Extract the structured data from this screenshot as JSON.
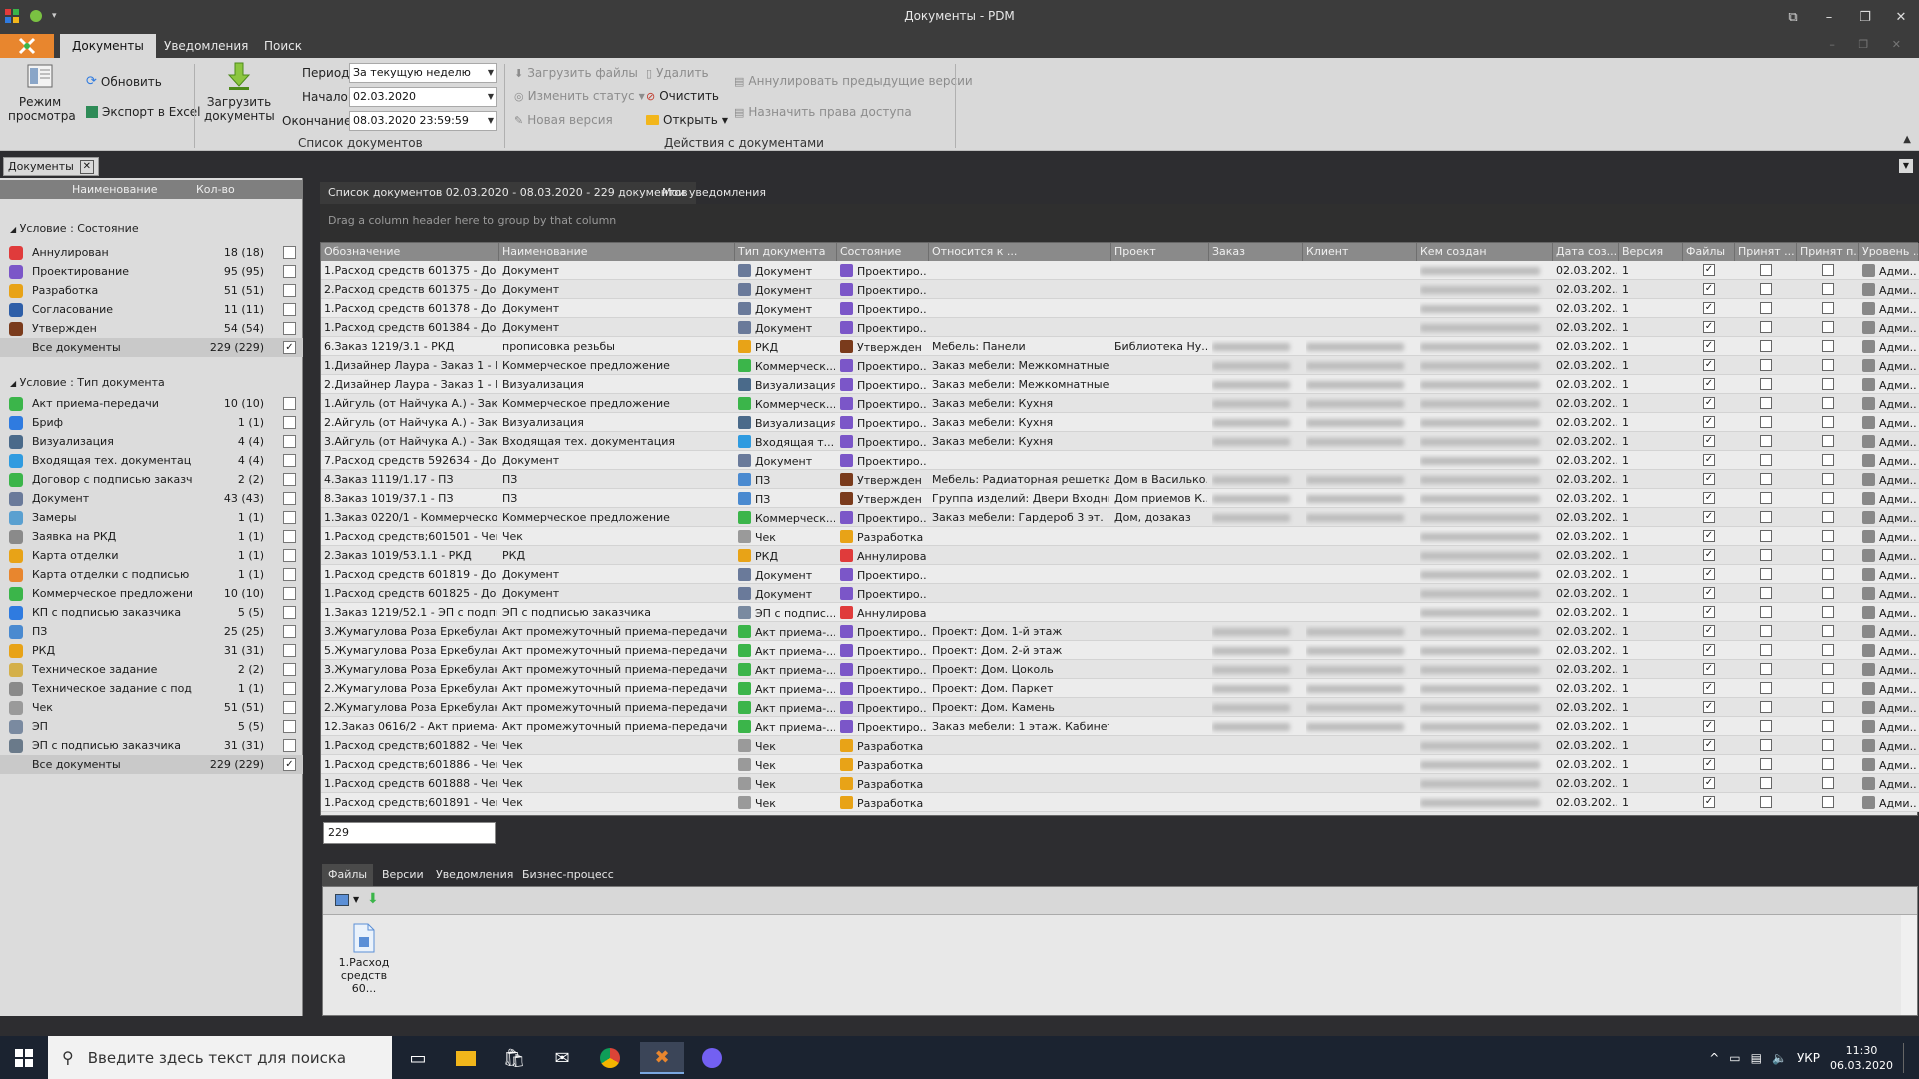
{
  "window": {
    "title": "Документы - PDM"
  },
  "ribbon_tabs": [
    "Документы",
    "Уведомления",
    "Поиск"
  ],
  "ribbon": {
    "view_mode": "Режим\nпросмотра",
    "refresh": "Обновить",
    "export_excel": "Экспорт в Excel",
    "load_docs": "Загрузить\nдокументы",
    "period_label": "Период",
    "period_value": "За текущую неделю",
    "start_label": "Начало",
    "start_value": "02.03.2020",
    "end_label": "Окончание",
    "end_value": "08.03.2020 23:59:59",
    "group_list": "Список документов",
    "load_files": "Загрузить файлы",
    "change_status": "Изменить статус",
    "new_version": "Новая версия",
    "delete": "Удалить",
    "clear": "Очистить",
    "open": "Открыть",
    "annul_prev": "Аннулировать предыдущие версии",
    "assign_rights": "Назначить права доступа",
    "group_actions": "Действия с документами"
  },
  "doc_tab": "Документы",
  "left_panel": {
    "col_name": "Наименование",
    "col_count": "Кол-во",
    "cond_state": "Условие : Состояние",
    "states": [
      {
        "name": "Аннулирован",
        "count": "18 (18)",
        "checked": false,
        "icon": "annulled-icon"
      },
      {
        "name": "Проектирование",
        "count": "95 (95)",
        "checked": false,
        "icon": "design-pen-icon"
      },
      {
        "name": "Разработка",
        "count": "51 (51)",
        "checked": false,
        "icon": "pencil-icon"
      },
      {
        "name": "Согласование",
        "count": "11 (11)",
        "checked": false,
        "icon": "approval-icon"
      },
      {
        "name": "Утвержден",
        "count": "54 (54)",
        "checked": false,
        "icon": "stamp-icon"
      },
      {
        "name": "Все документы",
        "count": "229 (229)",
        "checked": true,
        "icon": ""
      }
    ],
    "cond_type": "Условие : Тип документа",
    "types": [
      {
        "name": "Акт приема-передачи",
        "count": "10 (10)",
        "checked": false,
        "icon": "act-icon"
      },
      {
        "name": "Бриф",
        "count": "1 (1)",
        "checked": false,
        "icon": "info-icon"
      },
      {
        "name": "Визуализация",
        "count": "4 (4)",
        "checked": false,
        "icon": "image-icon"
      },
      {
        "name": "Входящая тех. документация",
        "count": "4 (4)",
        "checked": false,
        "icon": "incoming-icon"
      },
      {
        "name": "Договор с подписью заказч...",
        "count": "2 (2)",
        "checked": false,
        "icon": "contract-icon"
      },
      {
        "name": "Документ",
        "count": "43 (43)",
        "checked": false,
        "icon": "document-icon"
      },
      {
        "name": "Замеры",
        "count": "1 (1)",
        "checked": false,
        "icon": "measure-icon"
      },
      {
        "name": "Заявка на РКД",
        "count": "1 (1)",
        "checked": false,
        "icon": "request-icon"
      },
      {
        "name": "Карта отделки",
        "count": "1 (1)",
        "checked": false,
        "icon": "finish-map-icon"
      },
      {
        "name": "Карта отделки с подписью ...",
        "count": "1 (1)",
        "checked": false,
        "icon": "finish-map-signed-icon"
      },
      {
        "name": "Коммерческое предложение",
        "count": "10 (10)",
        "checked": false,
        "icon": "offer-icon"
      },
      {
        "name": "КП с подписью заказчика",
        "count": "5 (5)",
        "checked": false,
        "icon": "offer-signed-icon"
      },
      {
        "name": "ПЗ",
        "count": "25 (25)",
        "checked": false,
        "icon": "pz-icon"
      },
      {
        "name": "РКД",
        "count": "31 (31)",
        "checked": false,
        "icon": "rkd-icon"
      },
      {
        "name": "Техническое задание",
        "count": "2 (2)",
        "checked": false,
        "icon": "tz-icon"
      },
      {
        "name": "Техническое задание с под...",
        "count": "1 (1)",
        "checked": false,
        "icon": "tz-signed-icon"
      },
      {
        "name": "Чек",
        "count": "51 (51)",
        "checked": false,
        "icon": "receipt-icon"
      },
      {
        "name": "ЭП",
        "count": "5 (5)",
        "checked": false,
        "icon": "ep-icon"
      },
      {
        "name": "ЭП с подписью заказчика",
        "count": "31 (31)",
        "checked": false,
        "icon": "ep-signed-icon"
      },
      {
        "name": "Все документы",
        "count": "229 (229)",
        "checked": true,
        "icon": ""
      }
    ]
  },
  "main_tabs": [
    "Список документов 02.03.2020 - 08.03.2020 - 229 документов",
    "Мои уведомления"
  ],
  "group_hint": "Drag a column header here to group by that column",
  "grid": {
    "columns": [
      "Обозначение",
      "Наименование",
      "Тип документа",
      "Состояние",
      "Относится к ...",
      "Проект",
      "Заказ",
      "Клиент",
      "Кем создан",
      "Дата соз...",
      "Версия",
      "Файлы",
      "Принят ...",
      "Принят п...",
      "Уровень ..."
    ],
    "rows": [
      {
        "d": "1.Расход средств 601375 - Док...",
        "n": "Документ",
        "t": "Документ",
        "s": "Проектиро...",
        "r": "",
        "p": "",
        "o": false,
        "c": false,
        "date": "02.03.202...",
        "v": "1",
        "lvl": "Адми...",
        "ti": "document",
        "si": "design"
      },
      {
        "d": "2.Расход средств 601375 - Док...",
        "n": "Документ",
        "t": "Документ",
        "s": "Проектиро...",
        "r": "",
        "p": "",
        "o": false,
        "c": false,
        "date": "02.03.202...",
        "v": "1",
        "lvl": "Адми...",
        "ti": "document",
        "si": "design"
      },
      {
        "d": "1.Расход средств 601378 - Док...",
        "n": "Документ",
        "t": "Документ",
        "s": "Проектиро...",
        "r": "",
        "p": "",
        "o": false,
        "c": false,
        "date": "02.03.202...",
        "v": "1",
        "lvl": "Адми...",
        "ti": "document",
        "si": "design"
      },
      {
        "d": "1.Расход средств 601384 - Док...",
        "n": "Документ",
        "t": "Документ",
        "s": "Проектиро...",
        "r": "",
        "p": "",
        "o": false,
        "c": false,
        "date": "02.03.202...",
        "v": "1",
        "lvl": "Адми...",
        "ti": "document",
        "si": "design"
      },
      {
        "d": "6.Заказ 1219/3.1 - РКД",
        "n": "прописовка резьбы",
        "t": "РКД",
        "s": "Утвержден",
        "r": "Мебель: Панели",
        "p": "Библиотека Ну...",
        "o": true,
        "c": true,
        "date": "02.03.202...",
        "v": "1",
        "lvl": "Адми...",
        "ti": "rkd",
        "si": "approved"
      },
      {
        "d": "1.Дизайнер Лаура - Заказ 1 - К...",
        "n": "Коммерческое предложение",
        "t": "Коммерческ...",
        "s": "Проектиро...",
        "r": "Заказ мебели: Межкомнатные д...",
        "p": "",
        "o": true,
        "c": true,
        "date": "02.03.202...",
        "v": "1",
        "lvl": "Адми...",
        "ti": "offer",
        "si": "design"
      },
      {
        "d": "2.Дизайнер Лаура - Заказ 1 - Ви...",
        "n": "Визуализация",
        "t": "Визуализация",
        "s": "Проектиро...",
        "r": "Заказ мебели: Межкомнатные д...",
        "p": "",
        "o": true,
        "c": true,
        "date": "02.03.202...",
        "v": "1",
        "lvl": "Адми...",
        "ti": "image",
        "si": "design"
      },
      {
        "d": "1.Айгуль (от Найчука А.) - Зака...",
        "n": "Коммерческое предложение",
        "t": "Коммерческ...",
        "s": "Проектиро...",
        "r": "Заказ мебели: Кухня",
        "p": "",
        "o": true,
        "c": true,
        "date": "02.03.202...",
        "v": "1",
        "lvl": "Адми...",
        "ti": "offer",
        "si": "design"
      },
      {
        "d": "2.Айгуль (от Найчука А.) - Зака...",
        "n": "Визуализация",
        "t": "Визуализация",
        "s": "Проектиро...",
        "r": "Заказ мебели: Кухня",
        "p": "",
        "o": true,
        "c": true,
        "date": "02.03.202...",
        "v": "1",
        "lvl": "Адми...",
        "ti": "image",
        "si": "design"
      },
      {
        "d": "3.Айгуль (от Найчука А.) - Зака...",
        "n": "Входящая тех. документация",
        "t": "Входящая т...",
        "s": "Проектиро...",
        "r": "Заказ мебели: Кухня",
        "p": "",
        "o": true,
        "c": true,
        "date": "02.03.202...",
        "v": "1",
        "lvl": "Адми...",
        "ti": "incoming",
        "si": "design"
      },
      {
        "d": "7.Расход средств 592634 - Док...",
        "n": "Документ",
        "t": "Документ",
        "s": "Проектиро...",
        "r": "",
        "p": "",
        "o": false,
        "c": false,
        "date": "02.03.202...",
        "v": "1",
        "lvl": "Адми...",
        "ti": "document",
        "si": "design"
      },
      {
        "d": "4.Заказ 1119/1.17 - ПЗ",
        "n": "ПЗ",
        "t": "ПЗ",
        "s": "Утвержден",
        "r": "Мебель: Радиаторная решетка ...",
        "p": "Дом в Василько...",
        "o": true,
        "c": true,
        "date": "02.03.202...",
        "v": "1",
        "lvl": "Адми...",
        "ti": "pz",
        "si": "approved"
      },
      {
        "d": "8.Заказ 1019/37.1 - ПЗ",
        "n": "ПЗ",
        "t": "ПЗ",
        "s": "Утвержден",
        "r": "Группа изделий: Двери Входные",
        "p": "Дом приемов К...",
        "o": true,
        "c": true,
        "date": "02.03.202...",
        "v": "1",
        "lvl": "Адми...",
        "ti": "pz",
        "si": "approved"
      },
      {
        "d": "1.Заказ 0220/1 - Коммерческое ...",
        "n": "Коммерческое предложение",
        "t": "Коммерческ...",
        "s": "Проектиро...",
        "r": "Заказ мебели: Гардероб 3 эт.",
        "p": "Дом, дозаказ",
        "o": true,
        "c": true,
        "date": "02.03.202...",
        "v": "1",
        "lvl": "Адми...",
        "ti": "offer",
        "si": "design"
      },
      {
        "d": "1.Расход средств;601501 - Чек",
        "n": "Чек",
        "t": "Чек",
        "s": "Разработка",
        "r": "",
        "p": "",
        "o": false,
        "c": false,
        "date": "02.03.202...",
        "v": "1",
        "lvl": "Адми...",
        "ti": "receipt",
        "si": "dev"
      },
      {
        "d": "2.Заказ 1019/53.1.1 - РКД",
        "n": "РКД",
        "t": "РКД",
        "s": "Аннулирован",
        "r": "",
        "p": "",
        "o": false,
        "c": false,
        "date": "02.03.202...",
        "v": "1",
        "lvl": "Адми...",
        "ti": "rkd",
        "si": "annul"
      },
      {
        "d": "1.Расход средств 601819 - Док...",
        "n": "Документ",
        "t": "Документ",
        "s": "Проектиро...",
        "r": "",
        "p": "",
        "o": false,
        "c": false,
        "date": "02.03.202...",
        "v": "1",
        "lvl": "Адми...",
        "ti": "document",
        "si": "design"
      },
      {
        "d": "1.Расход средств 601825 - Док...",
        "n": "Документ",
        "t": "Документ",
        "s": "Проектиро...",
        "r": "",
        "p": "",
        "o": false,
        "c": false,
        "date": "02.03.202...",
        "v": "1",
        "lvl": "Адми...",
        "ti": "document",
        "si": "design"
      },
      {
        "d": "1.Заказ 1219/52.1 - ЭП с подпис...",
        "n": "ЭП с подписью заказчика",
        "t": "ЭП с подпис...",
        "s": "Аннулирован",
        "r": "",
        "p": "",
        "o": false,
        "c": false,
        "date": "02.03.202...",
        "v": "1",
        "lvl": "Адми...",
        "ti": "ep",
        "si": "annul"
      },
      {
        "d": "3.Жумагулова Роза Еркебулано...",
        "n": "Акт промежуточный приема-передачи",
        "t": "Акт приема-...",
        "s": "Проектиро...",
        "r": "Проект: Дом. 1-й этаж",
        "p": "",
        "o": true,
        "c": true,
        "date": "02.03.202...",
        "v": "1",
        "lvl": "Адми...",
        "ti": "act",
        "si": "design"
      },
      {
        "d": "5.Жумагулова Роза Еркебулано...",
        "n": "Акт промежуточный приема-передачи",
        "t": "Акт приема-...",
        "s": "Проектиро...",
        "r": "Проект: Дом. 2-й этаж",
        "p": "",
        "o": true,
        "c": true,
        "date": "02.03.202...",
        "v": "1",
        "lvl": "Адми...",
        "ti": "act",
        "si": "design"
      },
      {
        "d": "3.Жумагулова Роза Еркебулано...",
        "n": "Акт промежуточный приема-передачи",
        "t": "Акт приема-...",
        "s": "Проектиро...",
        "r": "Проект: Дом. Цоколь",
        "p": "",
        "o": true,
        "c": true,
        "date": "02.03.202...",
        "v": "1",
        "lvl": "Адми...",
        "ti": "act",
        "si": "design"
      },
      {
        "d": "2.Жумагулова Роза Еркебулано...",
        "n": "Акт промежуточный приема-передачи",
        "t": "Акт приема-...",
        "s": "Проектиро...",
        "r": "Проект: Дом. Паркет",
        "p": "",
        "o": true,
        "c": true,
        "date": "02.03.202...",
        "v": "1",
        "lvl": "Адми...",
        "ti": "act",
        "si": "design"
      },
      {
        "d": "2.Жумагулова Роза Еркебулано...",
        "n": "Акт промежуточный приема-передачи",
        "t": "Акт приема-...",
        "s": "Проектиро...",
        "r": "Проект: Дом. Камень",
        "p": "",
        "o": true,
        "c": true,
        "date": "02.03.202...",
        "v": "1",
        "lvl": "Адми...",
        "ti": "act",
        "si": "design"
      },
      {
        "d": "12.Заказ 0616/2 - Акт приема-п...",
        "n": "Акт промежуточный приема-передачи",
        "t": "Акт приема-...",
        "s": "Проектиро...",
        "r": "Заказ мебели: 1 этаж. Кабинет, ...",
        "p": "",
        "o": true,
        "c": true,
        "date": "02.03.202...",
        "v": "1",
        "lvl": "Адми...",
        "ti": "act",
        "si": "design"
      },
      {
        "d": "1.Расход средств;601882 - Чек",
        "n": "Чек",
        "t": "Чек",
        "s": "Разработка",
        "r": "",
        "p": "",
        "o": false,
        "c": false,
        "date": "02.03.202...",
        "v": "1",
        "lvl": "Адми...",
        "ti": "receipt",
        "si": "dev"
      },
      {
        "d": "1.Расход средств;601886 - Чек",
        "n": "Чек",
        "t": "Чек",
        "s": "Разработка",
        "r": "",
        "p": "",
        "o": false,
        "c": false,
        "date": "02.03.202...",
        "v": "1",
        "lvl": "Адми...",
        "ti": "receipt",
        "si": "dev"
      },
      {
        "d": "1.Расход средств 601888 - Чек",
        "n": "Чек",
        "t": "Чек",
        "s": "Разработка",
        "r": "",
        "p": "",
        "o": false,
        "c": false,
        "date": "02.03.202...",
        "v": "1",
        "lvl": "Адми...",
        "ti": "receipt",
        "si": "dev"
      },
      {
        "d": "1.Расход средств;601891 - Чек",
        "n": "Чек",
        "t": "Чек",
        "s": "Разработка",
        "r": "",
        "p": "",
        "o": false,
        "c": false,
        "date": "02.03.202...",
        "v": "1",
        "lvl": "Адми...",
        "ti": "receipt",
        "si": "dev"
      }
    ]
  },
  "row_count": "229",
  "bottom_tabs": [
    "Файлы",
    "Версии",
    "Уведомления",
    "Бизнес-процесс"
  ],
  "file_item": "1.Расход средств 60...",
  "taskbar": {
    "search_placeholder": "Введите здесь текст для поиска",
    "lang": "УКР",
    "time": "11:30",
    "date": "06.03.2020"
  },
  "colors": {
    "accent": "#e8862e",
    "ribbon_bg": "#d9d9d9",
    "dark_bg": "#2d2d30"
  }
}
